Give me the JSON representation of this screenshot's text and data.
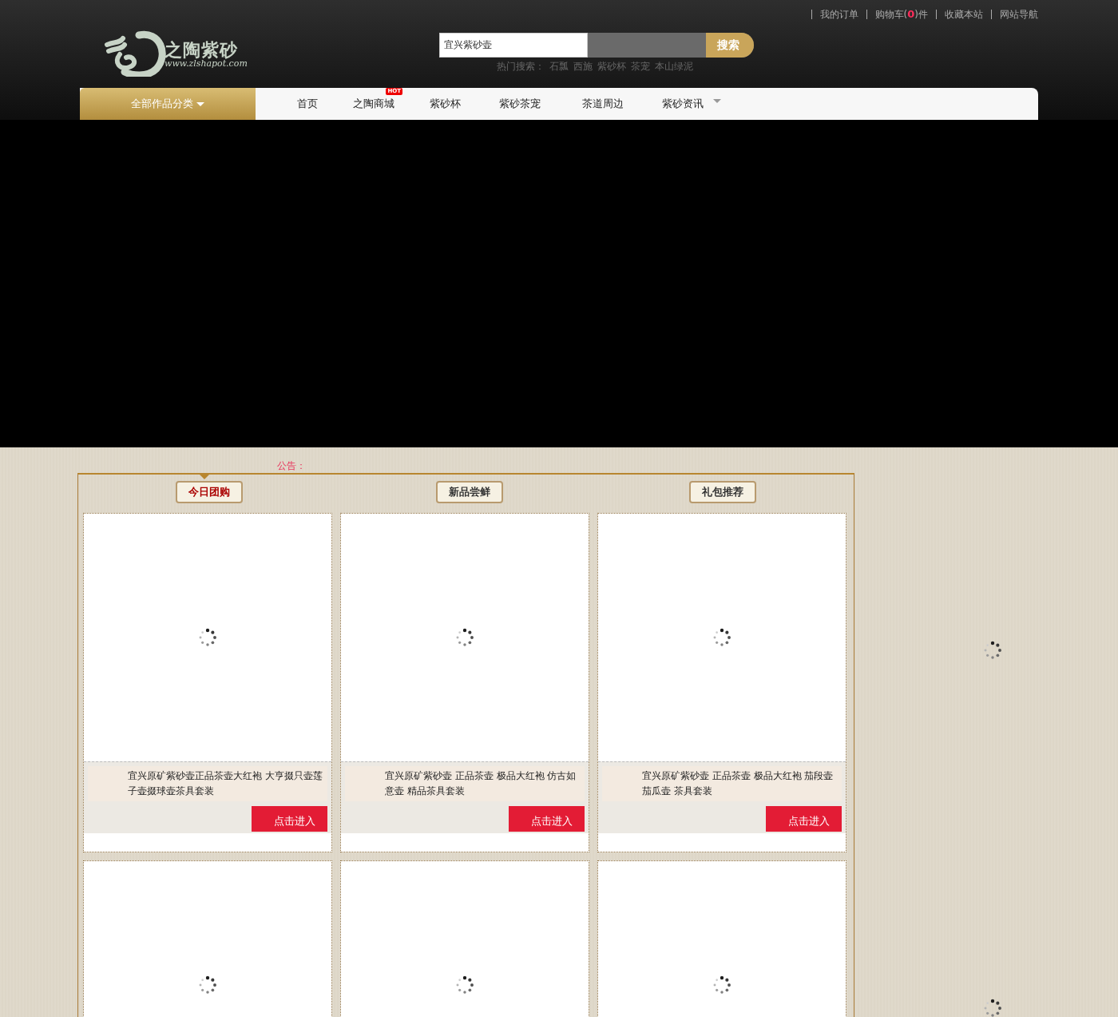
{
  "top_links": [
    {
      "kind": "plain",
      "label": "我的订单"
    },
    {
      "kind": "cart",
      "label": "购物车(",
      "count": "0",
      "suffix": ")件"
    },
    {
      "kind": "plain",
      "label": "收藏本站"
    },
    {
      "kind": "plain",
      "label": "网站导航"
    }
  ],
  "logo": {
    "name": "之陶紫砂",
    "url": "www.zlshapot.com"
  },
  "search": {
    "value": "宜兴紫砂壶",
    "button": "搜索"
  },
  "hot_search": {
    "label": "热门搜索：",
    "terms": [
      "石瓢",
      "西施",
      "紫砂杯",
      "茶宠",
      "本山绿泥"
    ]
  },
  "nav": {
    "category": "全部作品分类",
    "items": [
      {
        "label": "首页",
        "dropdown": false
      },
      {
        "label": "之陶商城",
        "badge": "HOT",
        "dropdown": false
      },
      {
        "label": "紫砂杯",
        "dropdown": false
      },
      {
        "label": "紫砂茶宠",
        "dropdown": false
      },
      {
        "label": "茶道周边",
        "dropdown": false
      },
      {
        "label": "紫砂资讯",
        "dropdown": true
      }
    ]
  },
  "notice": {
    "label": "公告："
  },
  "sections": [
    {
      "title": "今日团购",
      "selected": true
    },
    {
      "title": "新品尝鲜",
      "selected": false
    },
    {
      "title": "礼包推荐",
      "selected": false
    }
  ],
  "products": [
    {
      "kind": "product",
      "title": "宜兴原矿紫砂壶正品茶壶大红袍 大亨掇只壶莲子壶掇球壶茶具套装",
      "button": "点击进入"
    },
    {
      "kind": "product",
      "title": "宜兴原矿紫砂壶 正品茶壶 极品大红袍 仿古如意壶 精品茶具套装",
      "button": "点击进入"
    },
    {
      "kind": "product",
      "title": "宜兴原矿紫砂壶 正品茶壶 极品大红袍 茄段壶茄瓜壶 茶具套装",
      "button": "点击进入"
    },
    {
      "kind": "loading"
    },
    {
      "kind": "loading"
    },
    {
      "kind": "loading"
    }
  ],
  "side_slots": [
    {
      "kind": "loading"
    },
    {
      "kind": "loading"
    }
  ]
}
